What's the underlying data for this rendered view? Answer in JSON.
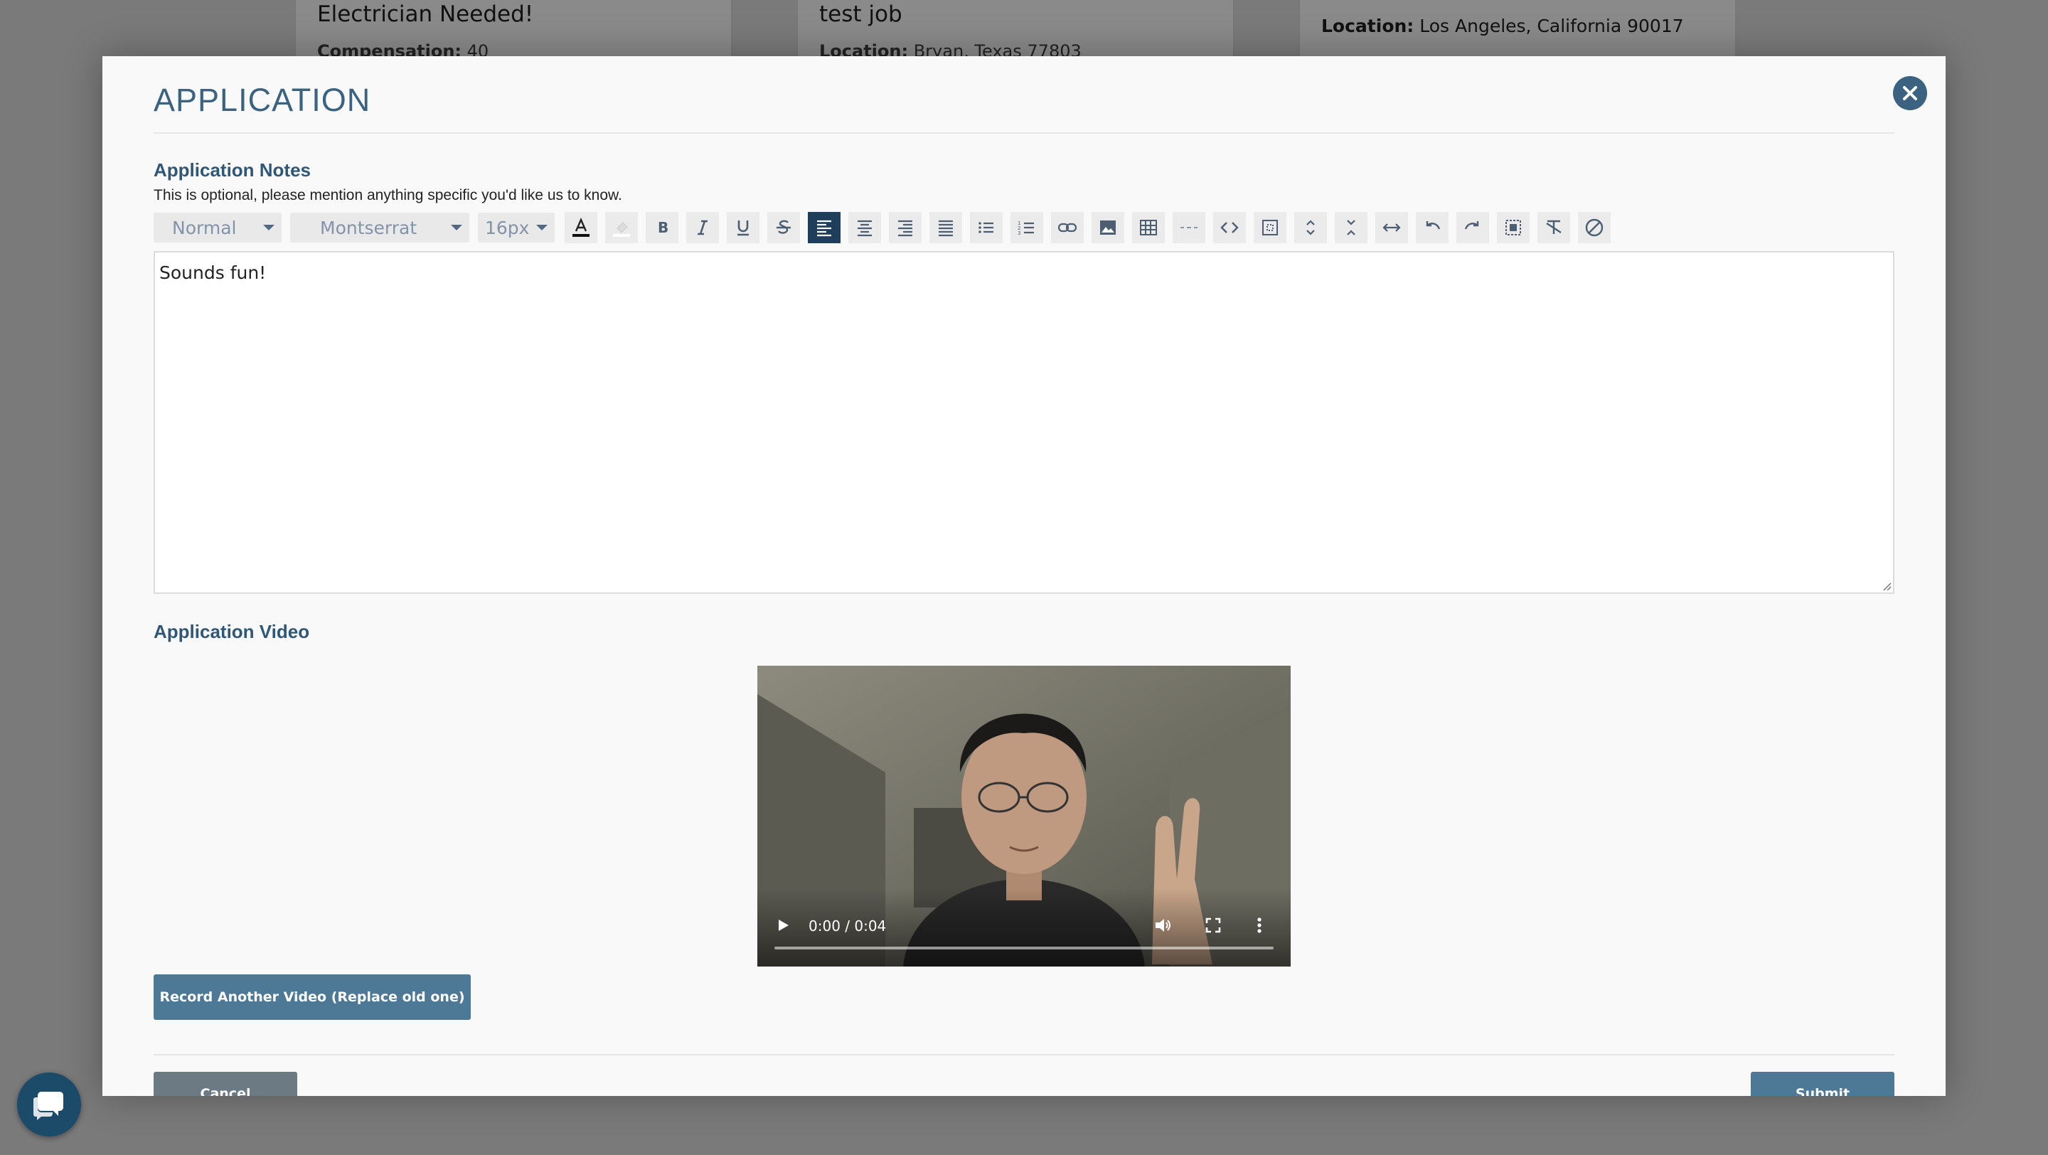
{
  "background_cards": [
    {
      "title": "Electrician Needed!",
      "field_label": "Compensation:",
      "field_value": "40"
    },
    {
      "title": "test job",
      "field_label": "Location:",
      "field_value": "Bryan, Texas 77803"
    },
    {
      "field_label": "Location:",
      "field_value": "Los Angeles, California 90017"
    }
  ],
  "modal": {
    "title": "APPLICATION",
    "notes_label": "Application Notes",
    "notes_help": "This is optional, please mention anything specific you'd like us to know.",
    "toolbar": {
      "paragraph_style": "Normal",
      "font": "Montserrat",
      "font_size": "16px",
      "buttons": [
        "font-color-icon",
        "highlight-color-icon",
        "bold-icon",
        "italic-icon",
        "underline-icon",
        "strikethrough-icon",
        "align-left-icon",
        "align-center-icon",
        "align-right-icon",
        "align-justify-icon",
        "bullet-list-icon",
        "numbered-list-icon",
        "link-icon",
        "image-icon",
        "table-icon",
        "horizontal-rule-icon",
        "code-view-icon",
        "fullscreen-icon",
        "line-height-up-icon",
        "line-height-down-icon",
        "letter-spacing-icon",
        "undo-icon",
        "redo-icon",
        "select-all-icon",
        "clear-format-icon",
        "disable-icon"
      ]
    },
    "notes_value": "Sounds fun!",
    "video_label": "Application Video",
    "video_time": "0:00 / 0:04",
    "record_button": "Record Another Video (Replace old one)",
    "cancel_button": "Cancel",
    "submit_button": "Submit"
  },
  "colors": {
    "accent": "#3c6282",
    "button": "#4e7996",
    "active_tool": "#1f3e5c"
  }
}
